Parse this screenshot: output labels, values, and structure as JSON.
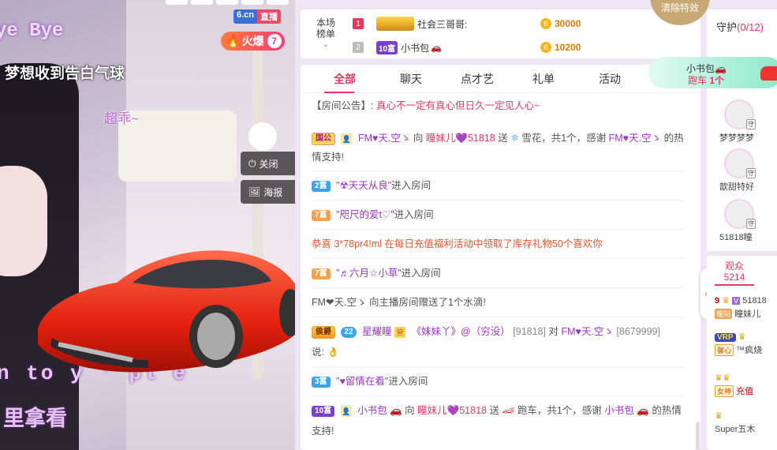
{
  "video": {
    "overlay_bye": "ye Bye",
    "overlay_dream": "梦想收到告白气球",
    "overlay_chaoguai": "超乖~",
    "overlay_song": "n to y   ' pl e",
    "overlay_lyric": "里拿看",
    "logo_left": "6.cn",
    "logo_right": "直播",
    "hot_label": "火爆",
    "hot_level": "7",
    "close_label": "关闭",
    "poster_label": "海报"
  },
  "rank": {
    "title_line1": "本场",
    "title_line2": "榜单",
    "rows": [
      {
        "num": "1",
        "badge": "",
        "name": "社会三哥哥:",
        "amount": "30000"
      },
      {
        "num": "2",
        "badge": "10富",
        "name": "小书包",
        "amount": "10200"
      }
    ],
    "clear_effects": "清除特效"
  },
  "chat": {
    "tabs": [
      "全部",
      "聊天",
      "点才艺",
      "礼单",
      "活动"
    ],
    "announcement_label": "【房间公告】:",
    "announcement_text": "真心不一定有真心但日久一定见人心~",
    "m1": {
      "tag": "国公",
      "user": "FM♥天.空ゝ",
      "to": "向",
      "target": "瞳妹儿💜51818",
      "action": "送",
      "gift": "雪花，共1个，感谢",
      "thanks_user": "FM♥天.空ゝ",
      "suffix": "的热情支持!"
    },
    "m2": {
      "tag": "2富",
      "user": "\"☢天天从良\"",
      "suffix": "进入房间"
    },
    "m3": {
      "tag": "7富",
      "user": "\"咫尺的爱t♡\"",
      "suffix": "进入房间"
    },
    "m4": {
      "text": "恭喜 3*78pr4!ml 在每日充值福利活动中领取了库存礼物50个喜欢你"
    },
    "m5": {
      "tag": "7富",
      "user": "\"♬六月☆小草\"",
      "suffix": "进入房间"
    },
    "m6": {
      "text": "FM❤天.空ゝ 向主播房间赠送了1个水滴!"
    },
    "m7": {
      "tag": "侯爵",
      "tag2": "22",
      "tag3": "星耀瞳",
      "user": "《妹妹丫》@（穷没）",
      "uid": "[91818]",
      "to": "对",
      "target": "FM♥天.空ゝ",
      "target_uid": "[8679999]",
      "says": "说:",
      "emoji": "👌"
    },
    "m8": {
      "tag": "3富",
      "user": "\"♥留情在看\"",
      "suffix": "进入房间"
    },
    "m9": {
      "tag": "10富",
      "user": "小书包",
      "to": "向",
      "target": "瞳妹儿💜51818",
      "action": "送",
      "gift": "跑车，共1个，感谢",
      "thanks_user": "小书包",
      "suffix": "的热情支持!"
    }
  },
  "guard": {
    "title": "守护",
    "count": "(0/12)",
    "users": [
      "梦梦梦梦",
      "歆甜特好",
      "51818瞳"
    ],
    "badge": "守"
  },
  "car_notice": {
    "line1": "小书包",
    "line2_a": "跑车",
    "line2_b": "1个"
  },
  "audience": {
    "tab_label": "观众",
    "tab_count": "5214",
    "rows": [
      {
        "lvl": "9",
        "name": "51818",
        "badge": "耀阳",
        "name2": "瞳妹儿"
      },
      {
        "lvl": "VRP",
        "name": "",
        "badge": "馨心",
        "name2": "™疯烧"
      },
      {
        "lvl": "",
        "name": "",
        "badge": "女神",
        "name2": "充值"
      },
      {
        "lvl": "",
        "name": "",
        "badge": "",
        "name2": "Super五木"
      }
    ]
  },
  "colors": {
    "accent": "#e9375e",
    "purple": "#9d36c9",
    "gold": "#e07b00"
  }
}
